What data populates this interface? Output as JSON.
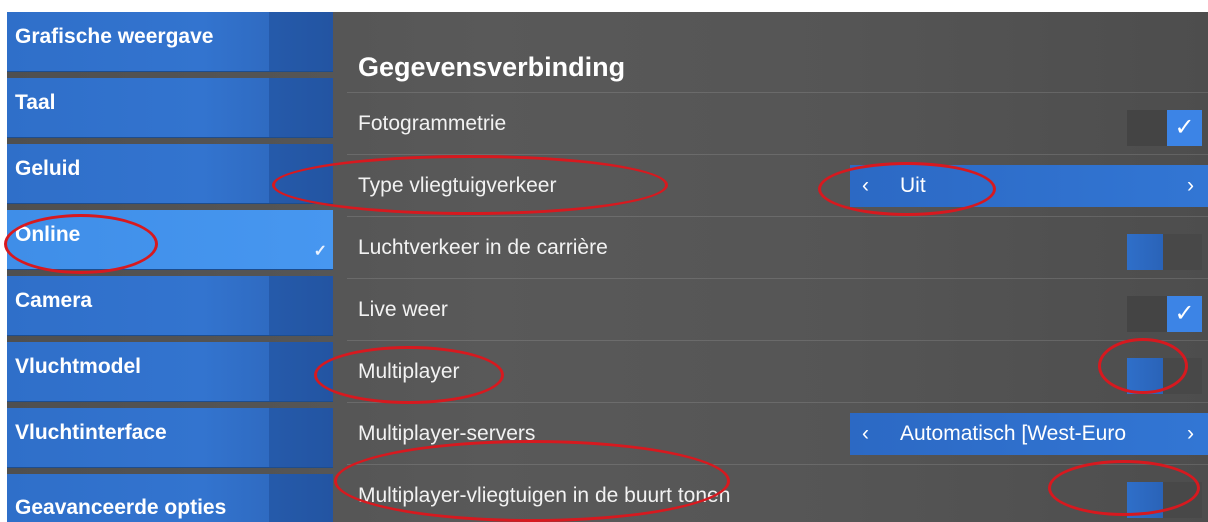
{
  "sidebar": {
    "items": [
      {
        "label": "Grafische weergave"
      },
      {
        "label": "Taal"
      },
      {
        "label": "Geluid"
      },
      {
        "label": "Online",
        "active_check": "✓"
      },
      {
        "label": "Camera"
      },
      {
        "label": "Vluchtmodel"
      },
      {
        "label": "Vluchtinterface"
      },
      {
        "label": "Geavanceerde opties"
      }
    ]
  },
  "main": {
    "title": "Gegevensverbinding",
    "settings": [
      {
        "label": "Fotogrammetrie",
        "control": "checkbox",
        "checked": true,
        "mark": "✓"
      },
      {
        "label": "Type vliegtuigverkeer",
        "control": "selector",
        "prev": "‹",
        "value": "Uit",
        "next": "›"
      },
      {
        "label": "Luchtverkeer in de carrière",
        "control": "toggle",
        "on": false
      },
      {
        "label": "Live weer",
        "control": "checkbox",
        "checked": true,
        "mark": "✓"
      },
      {
        "label": "Multiplayer",
        "control": "toggle",
        "on": false
      },
      {
        "label": "Multiplayer-servers",
        "control": "selector",
        "prev": "‹",
        "value": "Automatisch [West-Euro",
        "next": "›"
      },
      {
        "label": "Multiplayer-vliegtuigen in de buurt tonen",
        "control": "toggle",
        "on": false
      }
    ]
  },
  "colors": {
    "accent": "#3c84e6",
    "sidebar_item": "#3374cf",
    "sidebar_active": "#4797f0",
    "annotation": "#d7191f"
  }
}
